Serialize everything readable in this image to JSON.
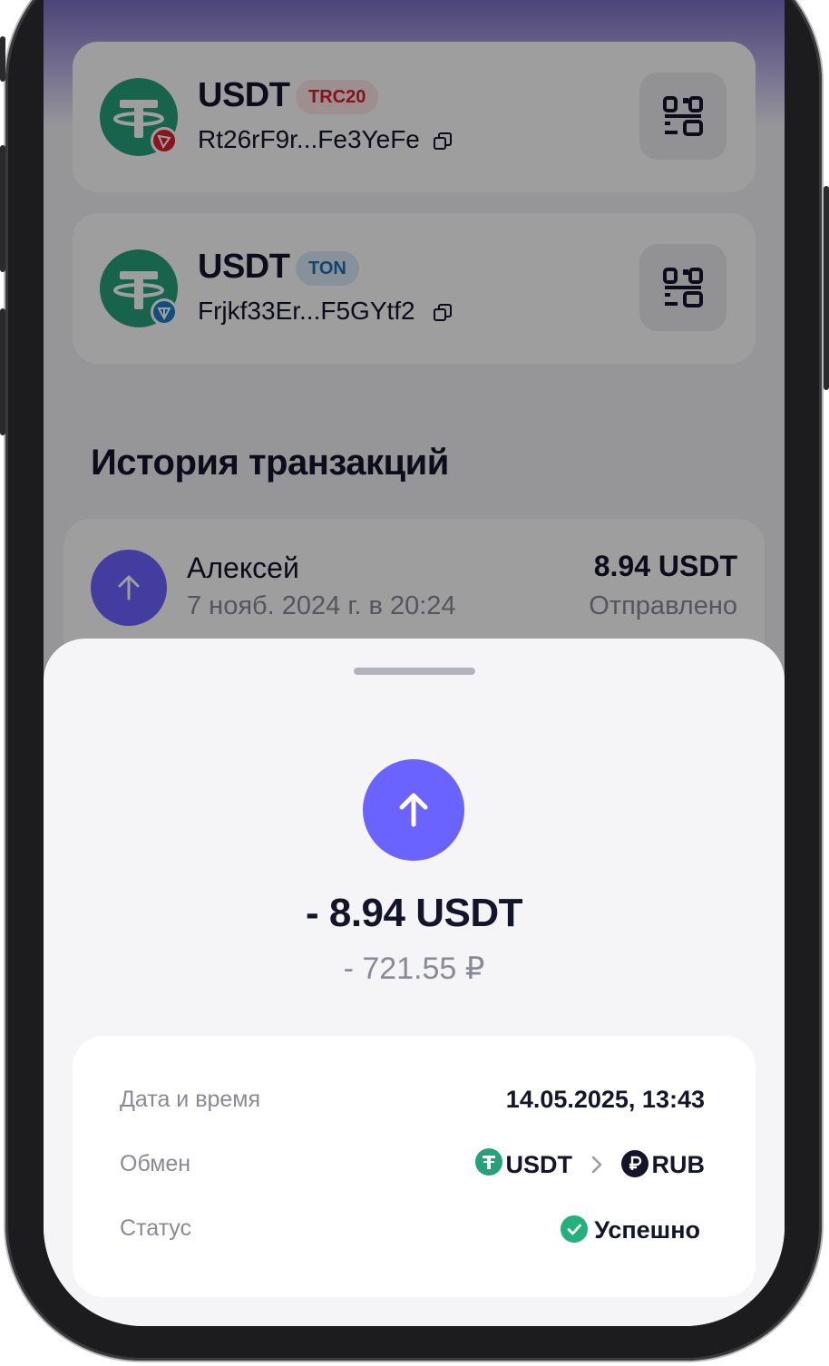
{
  "wallets": [
    {
      "coin": "USDT",
      "network": "TRC20",
      "address": "Rt26rF9r...Fe3YeFe"
    },
    {
      "coin": "USDT",
      "network": "TON",
      "address": "Frjkf33Er...F5GYtf2"
    }
  ],
  "history": {
    "title": "История транзакций",
    "item": {
      "name": "Алексей",
      "date": "7 нояб. 2024 г. в 20:24",
      "amount": "8.94 USDT",
      "status": "Отправлено"
    }
  },
  "sheet": {
    "amount": "- 8.94 USDT",
    "fiat": "- 721.55 ₽",
    "details": {
      "datetime_label": "Дата и время",
      "datetime_value": "14.05.2025, 13:43",
      "exchange_label": "Обмен",
      "exchange_from": "USDT",
      "exchange_to": "RUB",
      "status_label": "Статус",
      "status_value": "Успешно"
    }
  },
  "colors": {
    "accent": "#6b63ff",
    "tether": "#26a17b",
    "tron": "#e0202e",
    "ton": "#1f7cc4",
    "success": "#22b07d"
  }
}
